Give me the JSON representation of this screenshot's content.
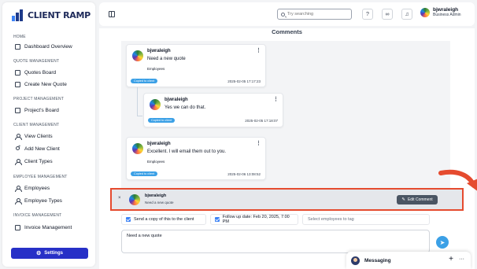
{
  "logo": {
    "text": "CLIENT RAMP"
  },
  "sidebar": {
    "sections": [
      {
        "label": "HOME"
      },
      {
        "label": "QUOTE MANAGEMENT"
      },
      {
        "label": "PROJECT MANAGEMENT"
      },
      {
        "label": "CLIENT MANAGEMENT"
      },
      {
        "label": "EMPLOYEE MANAGEMENT"
      },
      {
        "label": "INVOICE MANAGEMENT"
      }
    ],
    "items": [
      {
        "label": "Dashboard Overview",
        "icon": "box-icon"
      },
      {
        "label": "Quotes Board",
        "icon": "box-icon"
      },
      {
        "label": "Create New Quote",
        "icon": "box-icon"
      },
      {
        "label": "Project's Board",
        "icon": "box-icon"
      },
      {
        "label": "View Clients",
        "icon": "user-icon"
      },
      {
        "label": "Add New Client",
        "icon": "add-user-icon"
      },
      {
        "label": "Client Types",
        "icon": "user-icon"
      },
      {
        "label": "Employees",
        "icon": "user-icon"
      },
      {
        "label": "Employee Types",
        "icon": "user-icon"
      },
      {
        "label": "Invoice Management",
        "icon": "box-icon"
      }
    ],
    "settings_label": "Settings"
  },
  "header": {
    "search_placeholder": "Try searching",
    "user_name": "bjwraleigh",
    "user_role": "Business Admin"
  },
  "main": {
    "title": "Comments",
    "comments": [
      {
        "author": "bjwraleigh",
        "text": "Need a new quote",
        "audience": "Employees",
        "badge": "Copied to client",
        "timestamp": "2025-02-05 17:17:23"
      },
      {
        "author": "bjwraleigh",
        "text": "Yes we can do that.",
        "audience": "",
        "badge": "Copied to client",
        "timestamp": "2025-02-05 17:18:07"
      },
      {
        "author": "bjwraleigh",
        "text": "Excellent. I will email them out to you.",
        "audience": "Employees",
        "badge": "Copied to client",
        "timestamp": "2025-02-06 13:08:52"
      }
    ],
    "selected": {
      "close": "×",
      "author": "bjwraleigh",
      "text": "Need a new quote",
      "edit_label": "Edit Comment"
    },
    "options": {
      "copy_client_label": "Send a copy of this to the client",
      "follow_up_label": "Follow up date: Feb 20, 2025, 7:00 PM",
      "tag_placeholder": "Select employees to tag"
    },
    "input_value": "Need a new quote"
  },
  "messaging": {
    "label": "Messaging",
    "plus": "+",
    "dots": "···"
  },
  "colors": {
    "accent": "#2730c7",
    "badge": "#3ba0e6",
    "highlight": "#e54b2f"
  }
}
